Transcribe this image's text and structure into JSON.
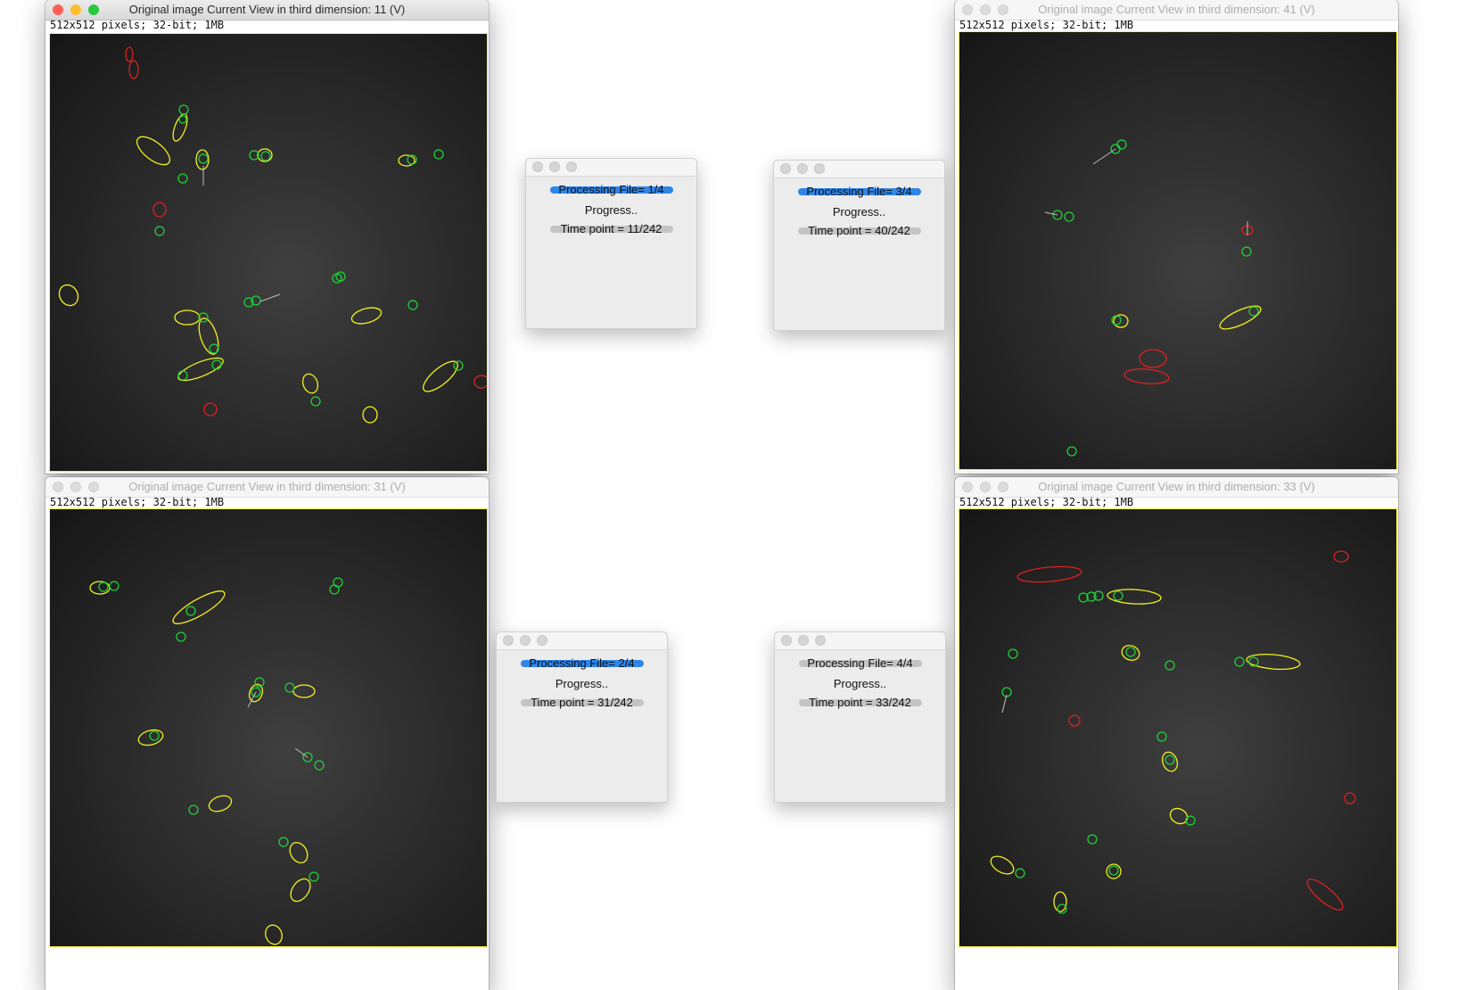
{
  "windows": [
    {
      "title": "Original image Current View in third dimension:  11 (V)",
      "info": "512x512 pixels; 32-bit; 1MB",
      "active": true
    },
    {
      "title": "Original image Current View in third dimension:  41 (V)",
      "info": "512x512 pixels; 32-bit; 1MB",
      "active": false
    },
    {
      "title": "Original image Current View in third dimension:  31 (V)",
      "info": "512x512 pixels; 32-bit; 1MB",
      "active": false
    },
    {
      "title": "Original image Current View in third dimension:  33 (V)",
      "info": "512x512 pixels; 32-bit; 1MB",
      "active": false
    }
  ],
  "dialogs": [
    {
      "processing": "Processing File= 1/4",
      "progress": "Progress..",
      "timepoint": "Time point = 11/242",
      "highlight": true
    },
    {
      "processing": "Processing File= 3/4",
      "progress": "Progress..",
      "timepoint": "Time point = 40/242",
      "highlight": true
    },
    {
      "processing": "Processing File= 2/4",
      "progress": "Progress..",
      "timepoint": "Time point = 31/242",
      "highlight": true
    },
    {
      "processing": "Processing File= 4/4",
      "progress": "Progress..",
      "timepoint": "Time point = 33/242",
      "highlight": false
    }
  ],
  "colors": {
    "yellow": "#f2f21e",
    "green": "#1fd13a",
    "red": "#e0211f",
    "selection": "#ffff3a"
  }
}
